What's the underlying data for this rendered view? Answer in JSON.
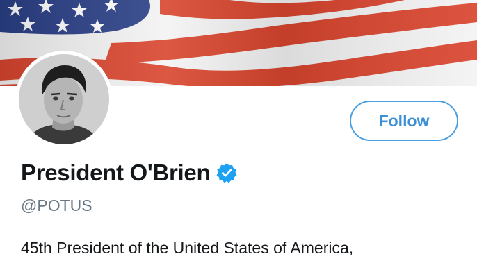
{
  "profile": {
    "display_name": "President O'Brien",
    "handle": "@POTUS",
    "bio": "45th President of the United States of America,",
    "verified": true,
    "follow_label": "Follow"
  },
  "icons": {
    "verified": "verified-badge-icon",
    "banner": "american-flag"
  },
  "colors": {
    "accent": "#4a9fe0",
    "verified_blue": "#1da1f2",
    "name_text": "#14171a",
    "handle_text": "#687785",
    "flag_red": "#d9452e",
    "flag_blue": "#2a3f86"
  }
}
